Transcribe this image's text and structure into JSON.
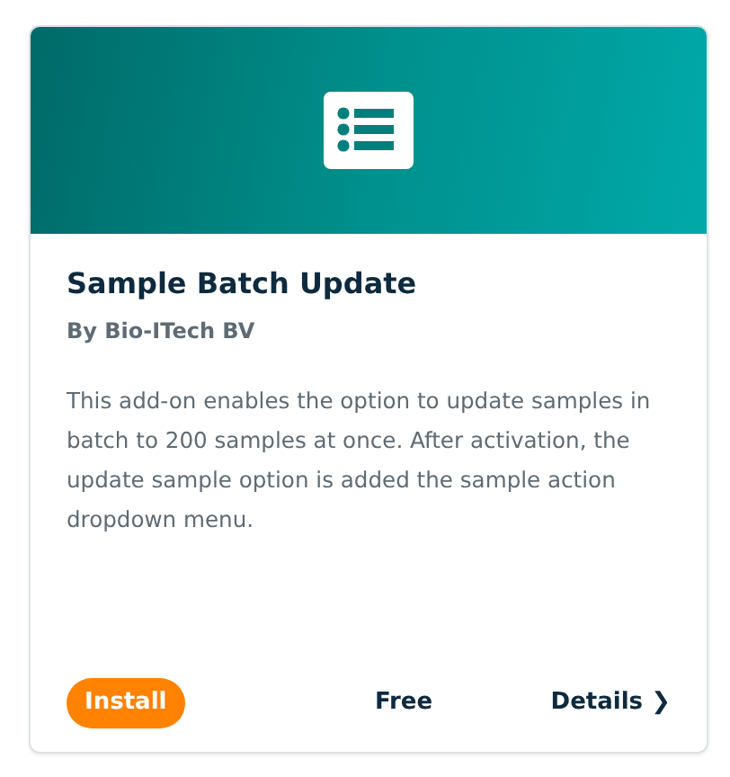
{
  "card": {
    "title": "Sample Batch Update",
    "author": "By Bio-ITech BV",
    "description": "This add-on enables the option to update samples in batch to 200 samples at once. After activation, the update sample option is added the sample action dropdown menu.",
    "footer": {
      "install_button": "Install",
      "price": "Free",
      "details_link": "Details",
      "details_icon": "❯"
    }
  }
}
